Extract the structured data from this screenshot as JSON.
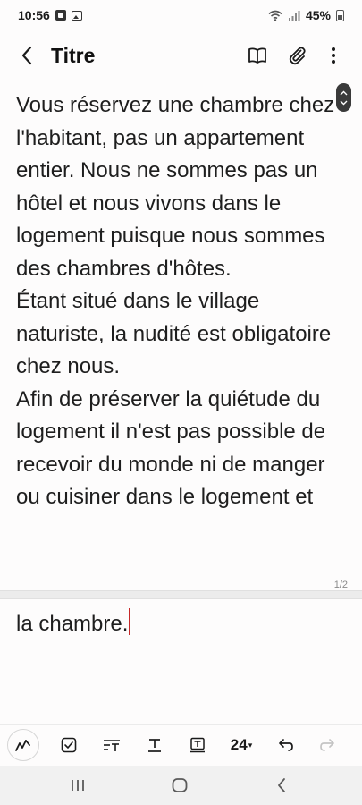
{
  "status_bar": {
    "time": "10:56",
    "battery_percent": "45%",
    "icons": [
      "notification-gallery-icon",
      "notification-image-icon",
      "wifi-icon",
      "signal-icon",
      "battery-icon"
    ]
  },
  "header": {
    "title": "Titre",
    "icons": [
      "back-arrow-icon",
      "book-icon",
      "paperclip-icon",
      "more-vertical-icon"
    ]
  },
  "content": {
    "paragraphs": [
      "Vous réservez une chambre chez l'habitant, pas un appartement entier. Nous ne sommes pas un hôtel et nous vivons dans le logement puisque nous sommes des chambres d'hôtes.",
      "Étant situé dans le village naturiste, la nudité est obligatoire chez nous.",
      "Afin de préserver la quiétude du logement il n'est pas possible de recevoir du monde ni de manger ou cuisiner dans le logement et"
    ],
    "continuation": "la chambre.",
    "page_counter": "1/2"
  },
  "toolbar": {
    "font_size": "24",
    "font_size_caret": "▾",
    "icons": [
      "pen-icon",
      "checkbox-icon",
      "text-format-icon",
      "text-underline-icon",
      "text-box-icon",
      "undo-icon",
      "redo-icon"
    ]
  },
  "nav_bar": {
    "icons": [
      "recents-icon",
      "home-icon",
      "back-icon"
    ]
  },
  "colors": {
    "background": "#fdfcfc",
    "text": "#1e1e1e",
    "cursor": "#c62828",
    "nav_bar": "#f1f1f1"
  }
}
